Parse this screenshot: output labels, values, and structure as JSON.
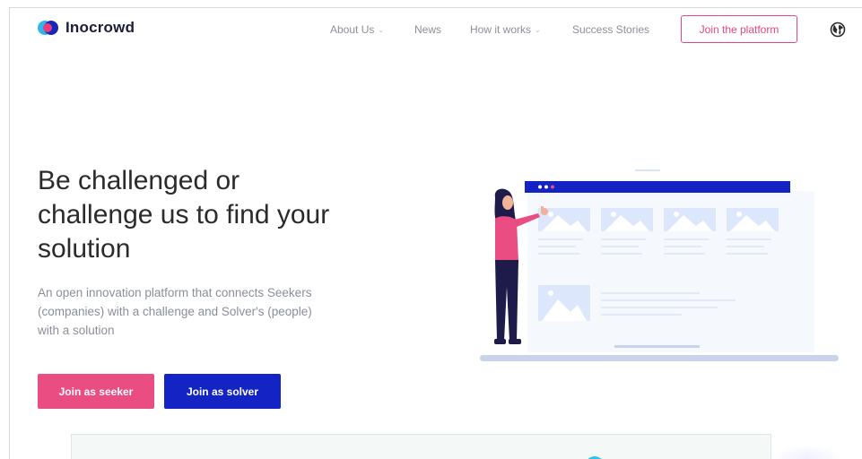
{
  "brand": {
    "name": "Inocrowd"
  },
  "nav": {
    "items": [
      {
        "label": "About Us",
        "has_dropdown": true
      },
      {
        "label": "News",
        "has_dropdown": false
      },
      {
        "label": "How it works",
        "has_dropdown": true
      },
      {
        "label": "Success Stories",
        "has_dropdown": false
      }
    ],
    "cta_label": "Join the platform",
    "language_icon": "globe-icon"
  },
  "hero": {
    "title": "Be challenged or challenge us to find your solution",
    "subtitle": "An open innovation platform that connects Seekers (companies) with a challenge and Solver's (people) with a solution",
    "seeker_button": "Join as seeker",
    "solver_button": "Join as solver"
  },
  "colors": {
    "accent_pink": "#e94d82",
    "accent_blue": "#1424c4",
    "logo_cyan": "#2fb5e8"
  }
}
